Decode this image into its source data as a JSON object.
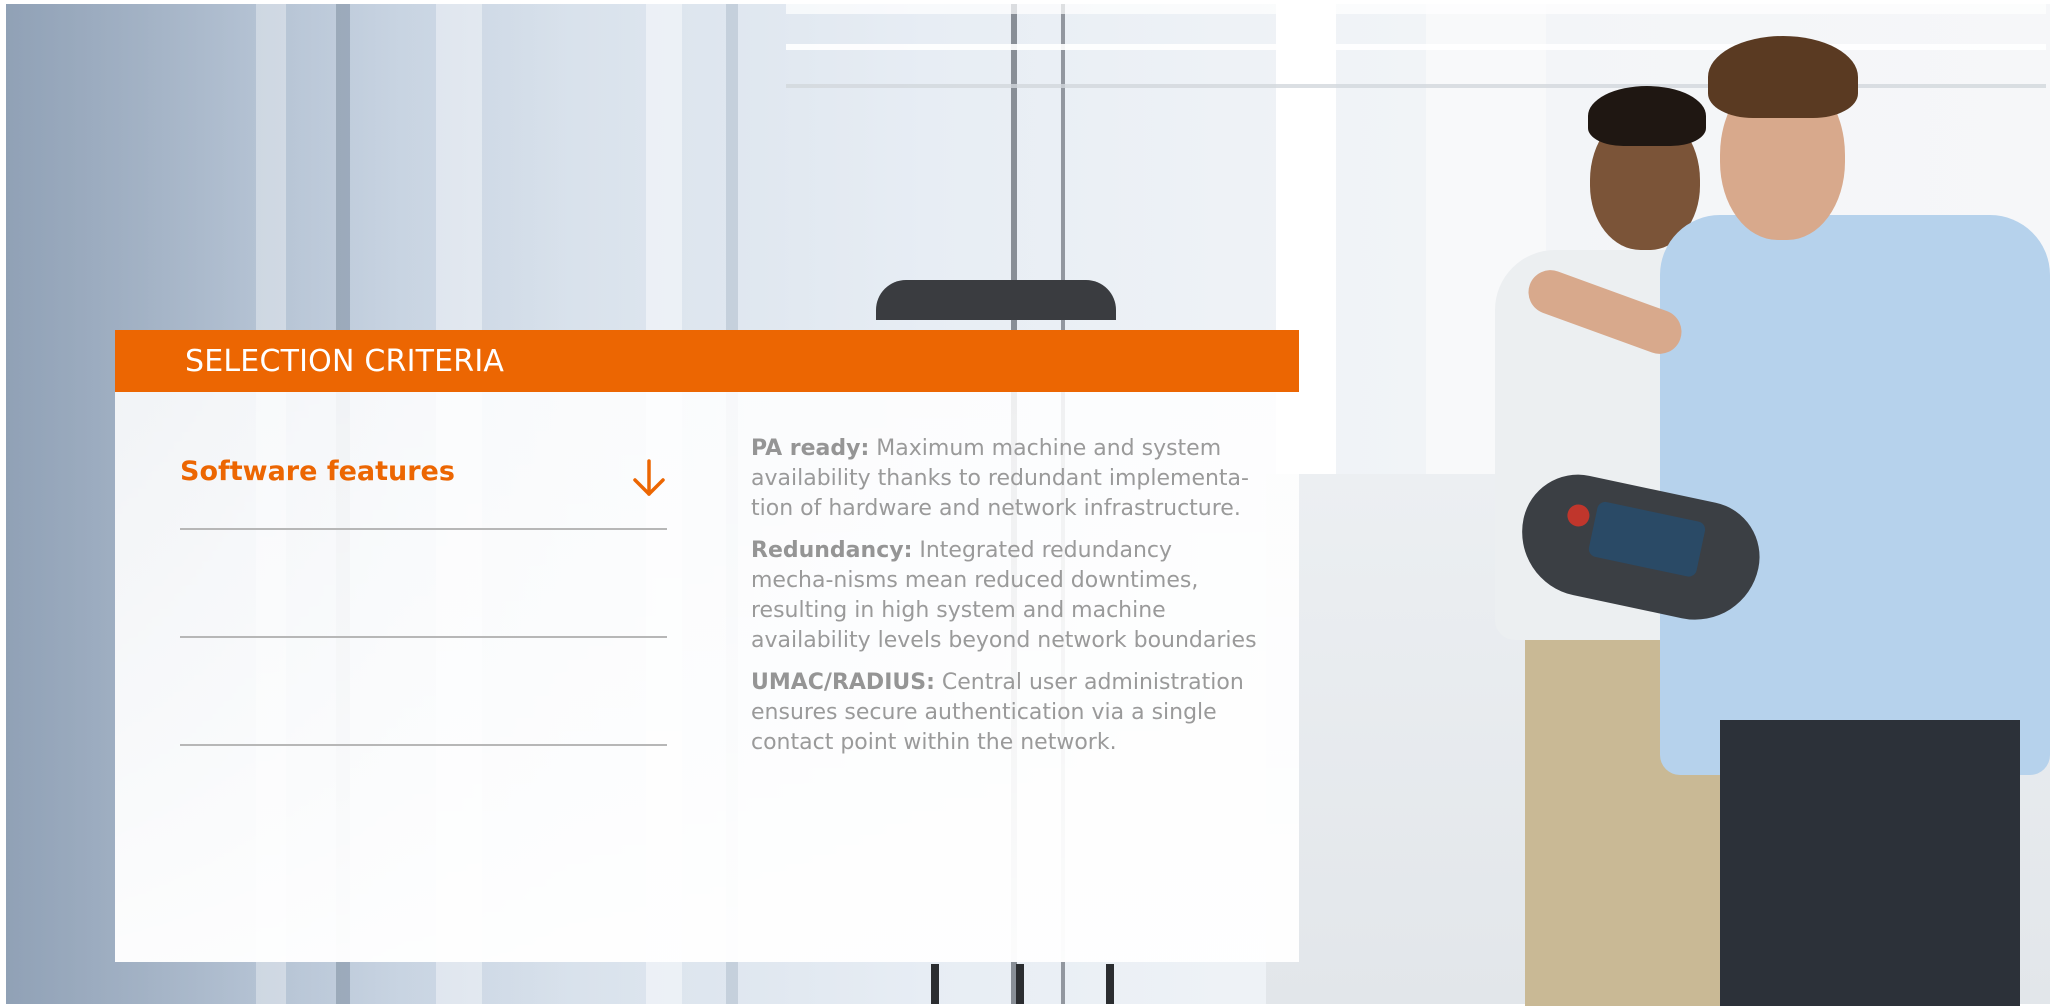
{
  "panel": {
    "title": "SELECTION CRITERIA"
  },
  "accordion": {
    "items": [
      {
        "label": "Software features",
        "icon": "arrow-down-icon",
        "expanded": true
      },
      {
        "label": ""
      },
      {
        "label": ""
      }
    ]
  },
  "details": [
    {
      "term": "PA ready:",
      "text": " Maximum machine and system availability thanks to redundant implementa-tion of hardware and network infrastructure."
    },
    {
      "term": "Redundancy:",
      "text": " Integrated redundancy mecha-nisms mean reduced downtimes, resulting in high system and machine availability levels beyond network boundaries"
    },
    {
      "term": "UMAC/RADIUS:",
      "text": " Central user administration ensures secure authentication via a single contact point within the network."
    }
  ],
  "colors": {
    "accent": "#ec6602",
    "text_muted": "#9a9a9a",
    "divider": "#b7b7b7"
  }
}
